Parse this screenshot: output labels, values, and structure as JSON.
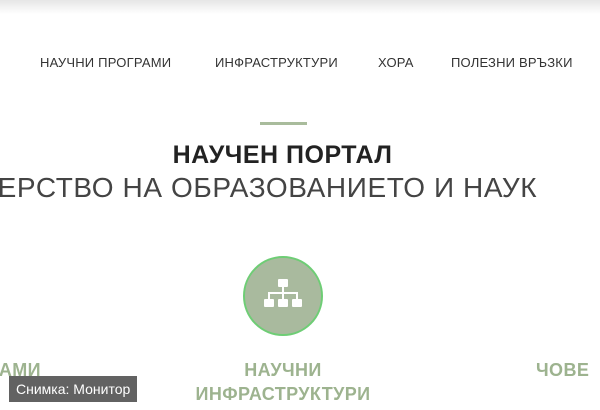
{
  "nav": {
    "items": [
      {
        "label": "НАУЧНИ ПРОГРАМИ"
      },
      {
        "label": "ИНФРАСТРУКТУРИ"
      },
      {
        "label": "ХОРА"
      },
      {
        "label": "ПОЛЕЗНИ ВРЪЗКИ"
      }
    ]
  },
  "hero": {
    "title": "НАУЧЕН ПОРТАЛ",
    "subtitle": "СТЕРСТВО НА ОБРАЗОВАНИЕТО И НАУК"
  },
  "cards": {
    "left": {
      "label_line1": "РАМИ"
    },
    "middle": {
      "label_line1": "НАУЧНИ",
      "label_line2": "ИНФРАСТРУКТУРИ",
      "icon": "sitemap-icon"
    },
    "right": {
      "label_line1": "ЧОВЕ"
    }
  },
  "caption": {
    "text": "Снимка: Монитор"
  },
  "colors": {
    "accent_green": "#a9ba9e",
    "heading_green": "#9db38f",
    "circle_border": "#6ecd75",
    "divider": "#a9bc9c"
  }
}
